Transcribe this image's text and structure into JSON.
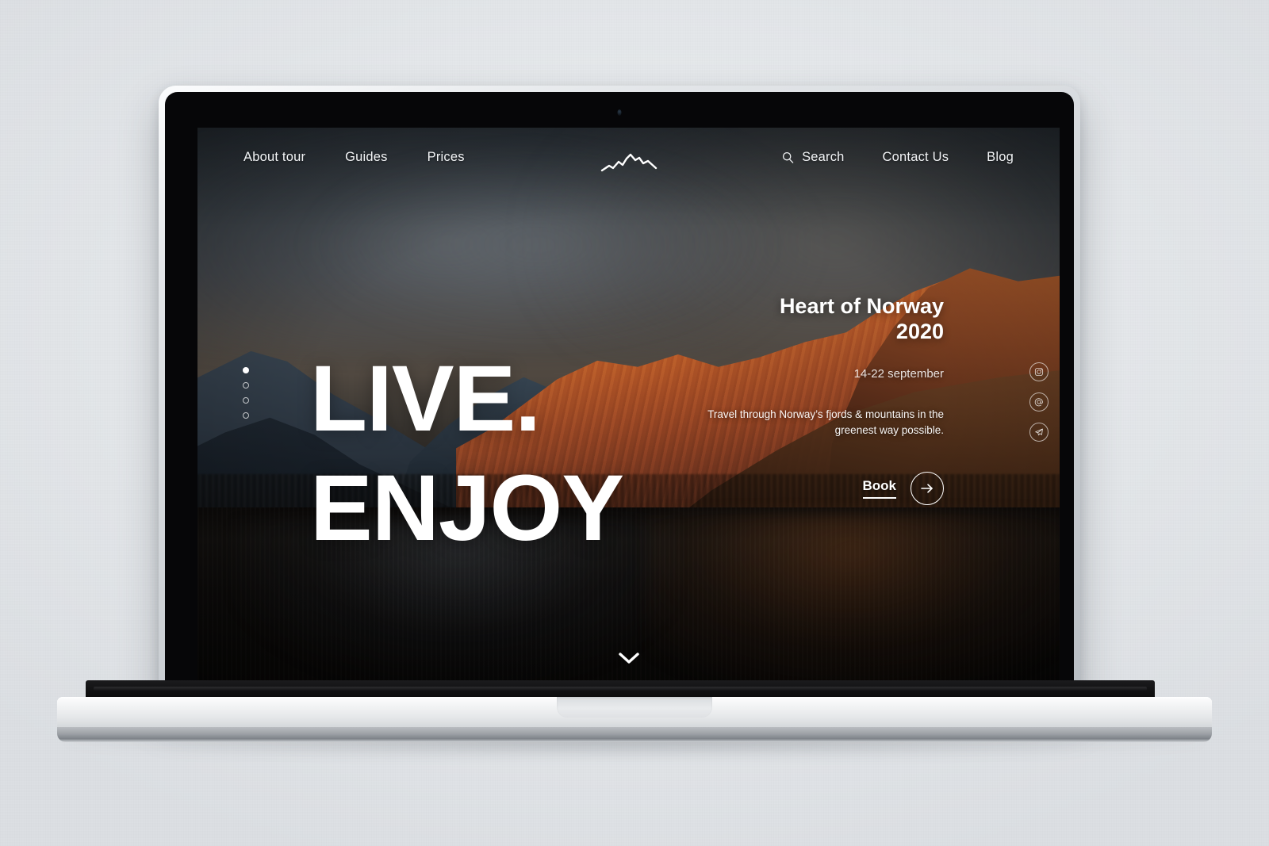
{
  "site": {
    "logo_icon": "mountain-range-logo-icon",
    "nav_left": [
      {
        "label": "About tour"
      },
      {
        "label": "Guides"
      },
      {
        "label": "Prices"
      }
    ],
    "nav_right": [
      {
        "label": "Search",
        "icon": "search-icon"
      },
      {
        "label": "Contact Us"
      },
      {
        "label": "Blog"
      }
    ]
  },
  "hero": {
    "headline_line1": "LIVE.",
    "headline_line2": "ENJOY",
    "scroll_cue_icon": "chevron-down-icon"
  },
  "slider": {
    "total": 4,
    "active_index": 0,
    "dots": [
      {
        "state": "active"
      },
      {
        "state": "idle"
      },
      {
        "state": "idle"
      },
      {
        "state": "idle"
      }
    ]
  },
  "tour": {
    "title": "Heart of Norway 2020",
    "title_line1": "Heart of Norway",
    "title_line2": "2020",
    "date": "14-22 september",
    "description": "Travel through Norway’s fjords & mountains in the greenest way possible.",
    "cta_label": "Book",
    "cta_icon": "arrow-right-icon"
  },
  "socials": [
    {
      "name": "instagram-icon"
    },
    {
      "name": "email-at-icon"
    },
    {
      "name": "telegram-icon"
    }
  ],
  "colors": {
    "text_primary": "#ffffff",
    "wall": "#e4e7ea",
    "bezel": "#060608",
    "mountain_warm": "#b9632b",
    "sky_cool": "#333a40"
  },
  "device": {
    "type": "laptop-mockup",
    "webcam": "webcam-dot"
  }
}
